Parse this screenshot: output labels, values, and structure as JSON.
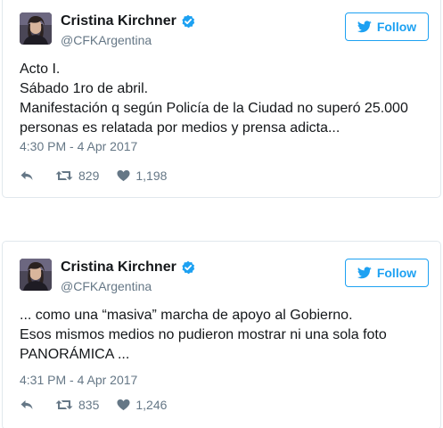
{
  "tweets": [
    {
      "display_name": "Cristina Kirchner",
      "handle": "@CFKArgentina",
      "follow_label": "Follow",
      "text_lines": [
        "Acto I.",
        "Sábado 1ro de abril.",
        "Manifestación q según Policía de la Ciudad no superó 25.000",
        "personas es relatada por medios y prensa adicta..."
      ],
      "timestamp": "4:30 PM - 4 Apr 2017",
      "retweets": "829",
      "likes": "1,198"
    },
    {
      "display_name": "Cristina Kirchner",
      "handle": "@CFKArgentina",
      "follow_label": "Follow",
      "text_lines": [
        "... como una “masiva” marcha de apoyo al Gobierno.",
        "Esos mismos medios no pudieron mostrar ni una sola foto",
        "PANORÁMICA ..."
      ],
      "timestamp": "4:31 PM - 4 Apr 2017",
      "retweets": "835",
      "likes": "1,246"
    }
  ],
  "icons": {
    "verified": "verified-badge-icon",
    "follow": "twitter-bird-icon",
    "reply": "reply-icon",
    "retweet": "retweet-icon",
    "like": "heart-icon"
  },
  "colors": {
    "accent": "#1da1f2",
    "text": "#14171a",
    "muted": "#657786",
    "border": "#e1e8ed"
  }
}
